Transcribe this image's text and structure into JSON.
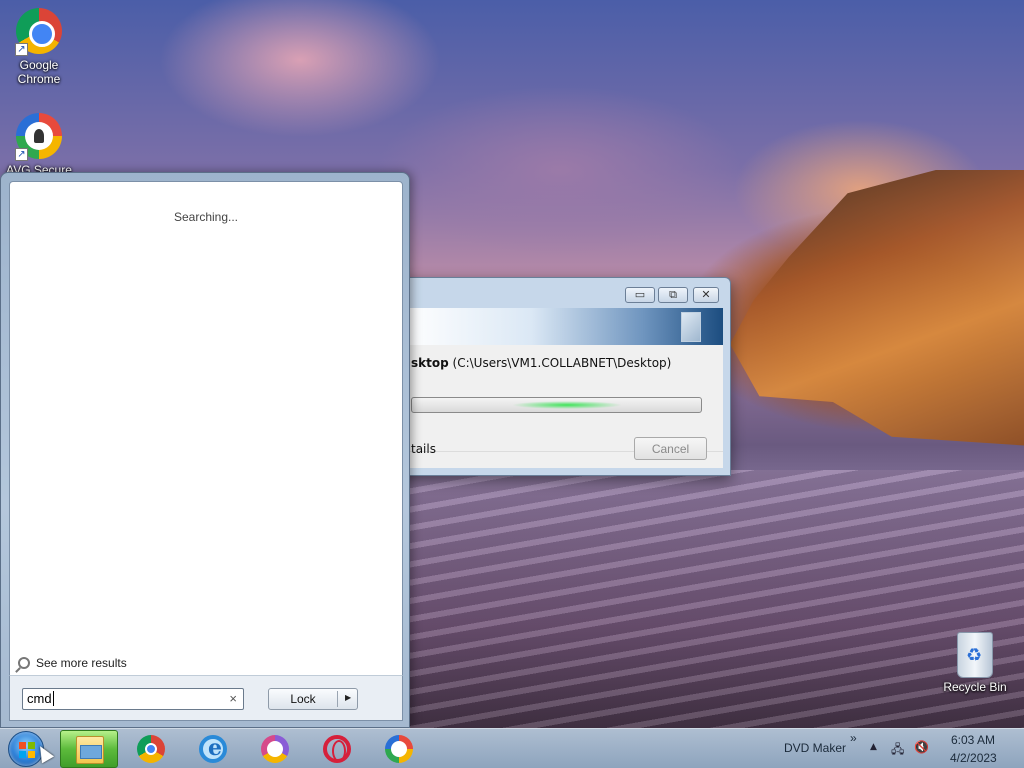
{
  "desktop": {
    "icons": [
      {
        "label": "Google\nChrome",
        "name": "google-chrome"
      },
      {
        "label": "AVG Secure",
        "name": "avg-secure"
      },
      {
        "label": "Recycle Bin",
        "name": "recycle-bin"
      }
    ]
  },
  "dialog": {
    "path_bold": "sktop",
    "path_rest": " (C:\\Users\\VM1.COLLABNET\\Desktop)",
    "details_label": "tails",
    "cancel_label": "Cancel",
    "minimize_glyph": "▭",
    "maximize_glyph": "⧉",
    "close_glyph": "✕"
  },
  "start_menu": {
    "status_text": "Searching...",
    "see_more_label": "See more results",
    "search_value": "cmd",
    "clear_glyph": "×",
    "power_button_label": "Lock",
    "power_arrow_glyph": "▶"
  },
  "taskbar": {
    "pinned": [
      {
        "name": "windows-explorer",
        "icon": "folder-icon",
        "active": true
      },
      {
        "name": "google-chrome",
        "icon": "chrome-icon",
        "active": false
      },
      {
        "name": "internet-explorer",
        "icon": "ie-icon",
        "active": false
      },
      {
        "name": "avg-browser",
        "icon": "avg-icon",
        "active": false
      },
      {
        "name": "opera",
        "icon": "opera-icon",
        "active": false
      },
      {
        "name": "avg-secure-browser",
        "icon": "avg-icon",
        "active": false
      }
    ],
    "toolbar_label": "DVD Maker",
    "toolbar_chevron": "»",
    "tray_arrow": "▲",
    "time": "6:03 AM",
    "date": "4/2/2023"
  }
}
